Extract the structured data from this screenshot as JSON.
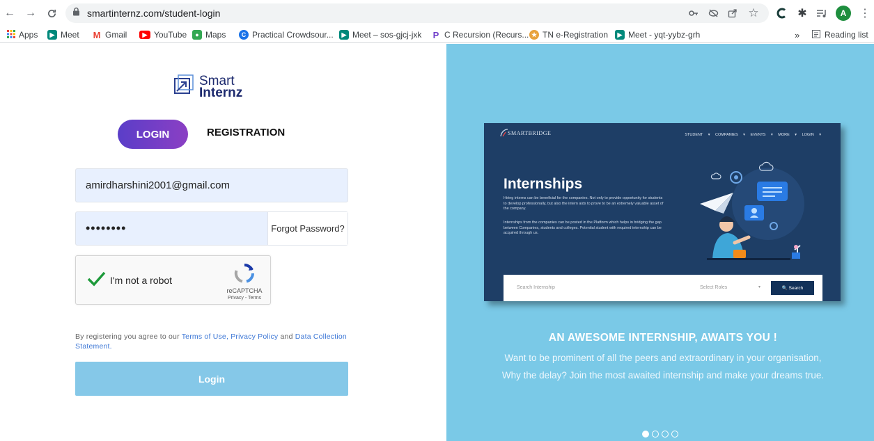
{
  "browser": {
    "url": "smartinternz.com/student-login",
    "profile_initial": "A",
    "bookmarks": [
      {
        "label": "Apps",
        "color": "#e8453c"
      },
      {
        "label": "Meet",
        "color": "#00897b"
      },
      {
        "label": "Gmail",
        "color": "#ea4335"
      },
      {
        "label": "YouTube",
        "color": "#ff0000"
      },
      {
        "label": "Maps",
        "color": "#34a853"
      },
      {
        "label": "Practical Crowdsour...",
        "color": "#1a73e8"
      },
      {
        "label": "Meet – sos-gjcj-jxk",
        "color": "#00897b"
      },
      {
        "label": "C Recursion (Recurs...",
        "color": "#6f3ec9"
      },
      {
        "label": "TN e-Registration",
        "color": "#e8a23c"
      },
      {
        "label": "Meet - yqt-yybz-grh",
        "color": "#00897b"
      }
    ],
    "overflow": "»",
    "reading_list": "Reading list"
  },
  "logo": {
    "line1": "Smart",
    "line2": "Internz"
  },
  "tabs": {
    "login": "LOGIN",
    "registration": "REGISTRATION"
  },
  "form": {
    "email_value": "amirdharshini2001@gmail.com",
    "password_value": "••••••••",
    "forgot_password": "Forgot Password?",
    "captcha_label": "I'm not a robot",
    "captcha_brand": "reCAPTCHA",
    "captcha_links": "Privacy - Terms",
    "agree_prefix": "By registering you agree to our",
    "terms_link": "Terms of Use,",
    "privacy_link": "Privacy Policy",
    "and_word": "and",
    "data_link": "Data Collection Statement.",
    "login_button": "Login"
  },
  "showcase": {
    "brand": "SMARTBRIDGE",
    "menu": "STUDENT ▾ COMPANIES ▾ EVENTS ▾ MORE ▾ LOGIN ▾",
    "title": "Internships",
    "para1": "Hiring interns can be beneficial for the companies. Not only to provide opportunity for students to develop professionally, but also the intern aids to prove to be an extremely valuable asset of the company.",
    "para2": "Internships from the companies can be posted in the Platform which helps in bridging the gap between Companies, students and colleges. Potential student with required internship can be acquired through us.",
    "search_placeholder": "Search Internship",
    "select_roles": "Select Roles",
    "search_button": "🔍 Search"
  },
  "promo": {
    "headline": "AN AWESOME INTERNSHIP, AWAITS YOU !",
    "line1": "Want to be prominent of all the peers and extraordinary in your organisation,",
    "line2": "Why the delay? Join the most awaited internship and make your dreams true."
  },
  "carousel": {
    "total": 4,
    "active": 1
  },
  "colors": {
    "accent_start": "#5a3ec8",
    "accent_end": "#8b3fc4",
    "panel_blue": "#7ac9e7",
    "login_button": "#85c8e8",
    "link": "#3e78d6"
  }
}
